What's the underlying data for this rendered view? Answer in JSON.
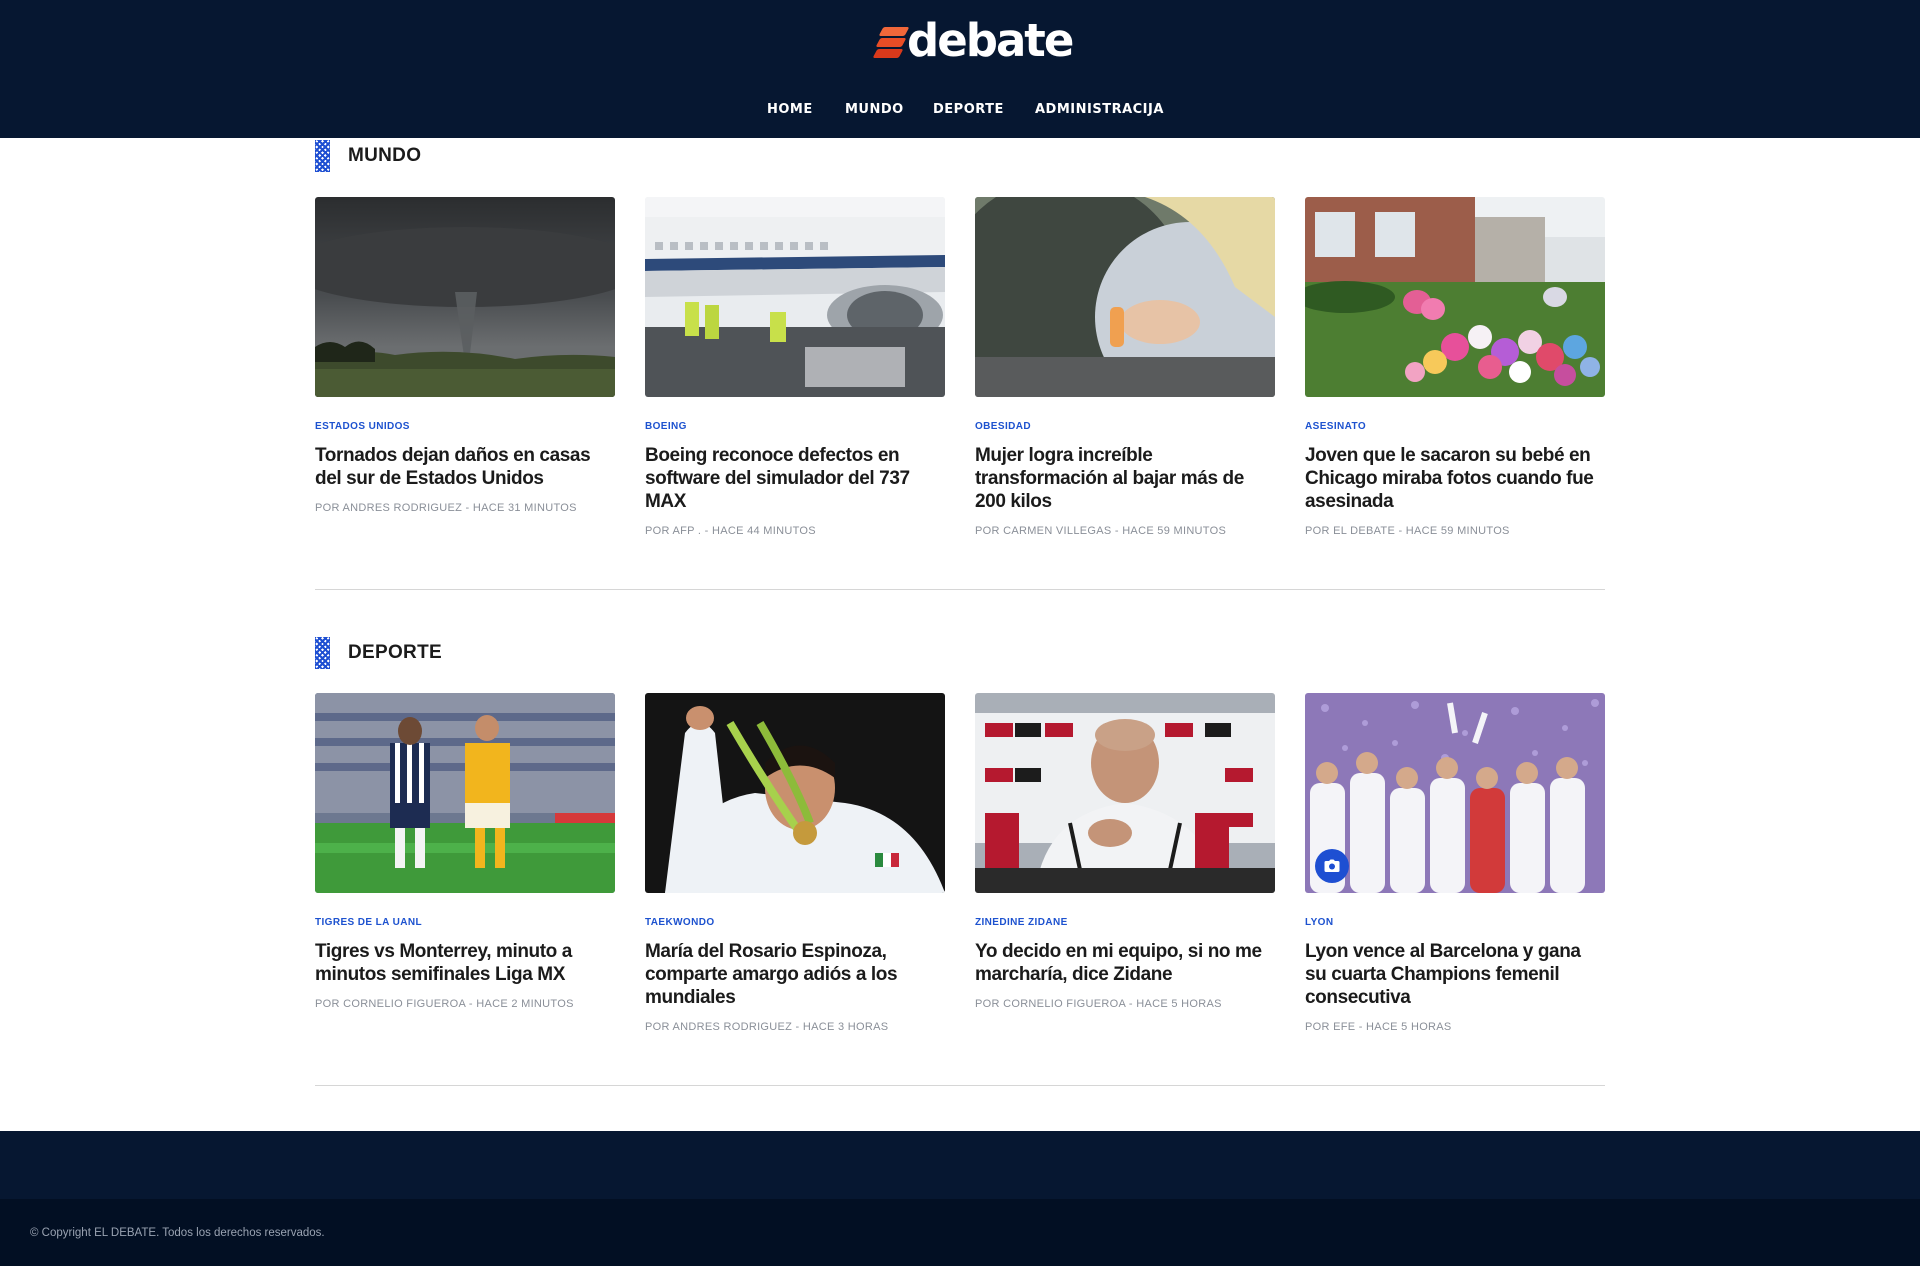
{
  "site": {
    "logo_text": "debate",
    "brand_color": "#f0673a",
    "header_bg": "#061731"
  },
  "nav": {
    "items": [
      {
        "label": "HOME"
      },
      {
        "label": "MUNDO"
      },
      {
        "label": "DEPORTE"
      },
      {
        "label": "ADMINISTRACIJA"
      }
    ]
  },
  "sections": [
    {
      "title": "MUNDO",
      "articles": [
        {
          "kicker": "ESTADOS UNIDOS",
          "headline": "Tornados dejan daños en casas del sur de Estados Unidos",
          "byline": "POR ANDRES RODRIGUEZ - HACE 31 MINUTOS",
          "image": "tornado"
        },
        {
          "kicker": "BOEING",
          "headline": "Boeing reconoce defectos en software del simulador del 737 MAX",
          "byline": "POR AFP . - HACE 44 MINUTOS",
          "image": "airplane"
        },
        {
          "kicker": "OBESIDAD",
          "headline": "Mujer logra increíble transformación al bajar más de 200 kilos",
          "byline": "POR CARMEN VILLEGAS - HACE 59 MINUTOS",
          "image": "belly"
        },
        {
          "kicker": "ASESINATO",
          "headline": "Joven que le sacaron su bebé en Chicago miraba fotos cuando fue asesinada",
          "byline": "POR EL DEBATE - HACE 59 MINUTOS",
          "image": "memorial"
        }
      ]
    },
    {
      "title": "DEPORTE",
      "articles": [
        {
          "kicker": "TIGRES DE LA UANL",
          "headline": "Tigres vs Monterrey, minuto a minutos semifinales Liga MX",
          "byline": "POR CORNELIO FIGUEROA - HACE 2 MINUTOS",
          "image": "soccer"
        },
        {
          "kicker": "TAEKWONDO",
          "headline": "María del Rosario Espinoza, comparte amargo adiós a los mundiales",
          "byline": "POR ANDRES RODRIGUEZ - HACE 3 HORAS",
          "image": "medal"
        },
        {
          "kicker": "ZINEDINE ZIDANE",
          "headline": "Yo decido en mi equipo, si no me marcharía, dice Zidane",
          "byline": "POR CORNELIO FIGUEROA - HACE 5 HORAS",
          "image": "press"
        },
        {
          "kicker": "LYON",
          "headline": "Lyon vence al Barcelona y gana su cuarta Champions femenil consecutiva",
          "byline": "POR EFE - HACE 5 HORAS",
          "image": "celebration",
          "gallery_icon": "camera-icon"
        }
      ]
    }
  ],
  "footer": {
    "copyright": "© Copyright EL DEBATE. Todos los derechos reservados."
  }
}
